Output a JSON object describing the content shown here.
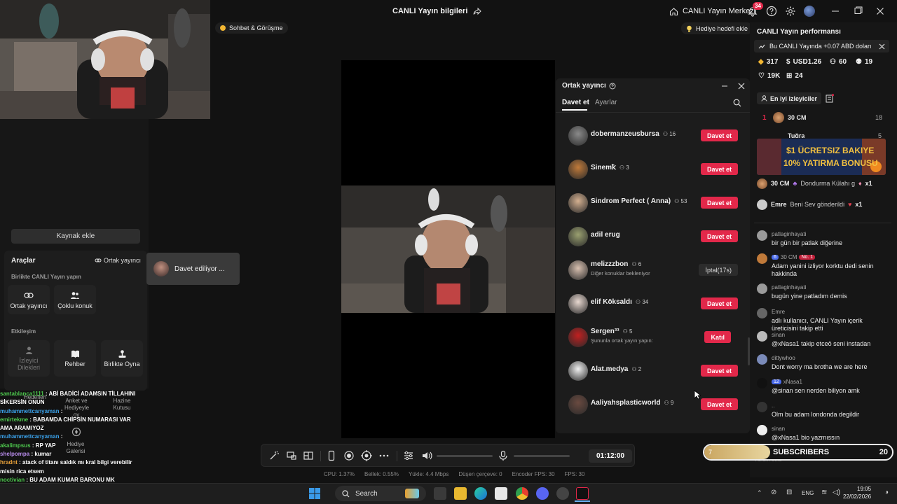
{
  "titlebar": {
    "title": "CANLI Yayın bilgileri",
    "live_center": "CANLI Yayın Merkezi",
    "notifications": "34"
  },
  "left": {
    "kaynak_ekle": "Kaynak ekle",
    "tools_title": "Araçlar",
    "ortak_link": "Ortak yayıncı",
    "section_together": "Birlikte CANLI Yayın yapın",
    "tile_ortak": "Ortak yayıncı",
    "tile_coklu": "Çoklu konuk",
    "section_interaction": "Etkileşim",
    "tile_izleyici": "İzleyici Dilekleri",
    "tile_rehber": "Rehber",
    "tile_birlikte_oyna": "Birlikte Oyna",
    "tile_anket": "Anket ve Hediyeyle oy",
    "tile_hazine": "Hazine Kutusu",
    "tile_hediye_galerisi": "Hediye Galerisi",
    "tile_hedefleri": "Hedefleri",
    "invite_toast": "Davet ediliyor ..."
  },
  "chat_overlay": [
    {
      "user": "santablanca1111",
      "text": ": ABİ BADİCİ ADAMSIN TİLLAHINI SİKERSİN ONUN",
      "color": "#4ec94e"
    },
    {
      "user": "muhammettcanyaman",
      "text": ":",
      "color": "#3aa0e8"
    },
    {
      "user": "emirtekme",
      "text": ": BABAMDA CHİPSİN NUMARASI VAR AMA ARAMIYOZ",
      "color": "#4ec94e"
    },
    {
      "user": "muhammettcanyaman",
      "text": ":",
      "color": "#3aa0e8"
    },
    {
      "user": "akalimpsus",
      "text": ": RP YAP",
      "color": "#4ec94e"
    },
    {
      "user": "shelpompa",
      "text": ": kumar",
      "color": "#b58ae8"
    },
    {
      "user": "hradnt",
      "text": ": atack of titanı saldık mı kral bilgi verebilir misin rica etsem",
      "color": "#e8a13a"
    },
    {
      "user": "noctivian",
      "text": ": BU ADAM KUMAR BARONU MK TEHLİKEDE DEĞİL TEHLİKENİN KENDİSİ MUSDAFA YÜZÜDÜK",
      "color": "#4ec94e"
    }
  ],
  "stage": {
    "sohbet": "Sohbet & Görüşme",
    "hediye_hedefi": "Hediye hedefi ekle"
  },
  "cohost": {
    "title": "Ortak yayıncı",
    "tab_invite": "Davet et",
    "tab_settings": "Ayarlar",
    "rows": [
      {
        "name": "dobermanzeusbursa",
        "count": "16",
        "button": "Davet et",
        "sub": ""
      },
      {
        "name": "Sinemꝁ",
        "count": "3",
        "button": "Davet et",
        "sub": ""
      },
      {
        "name": "Sindrom Perfect ( Anna)",
        "count": "53",
        "button": "Davet et",
        "sub": ""
      },
      {
        "name": "adil erug",
        "count": "",
        "button": "Davet et",
        "sub": ""
      },
      {
        "name": "melizzzbon",
        "count": "6",
        "button": "İptal(17s)",
        "sub": "Diğer konuklar bekleniyor"
      },
      {
        "name": "elif Köksaldı",
        "count": "34",
        "button": "Davet et",
        "sub": ""
      },
      {
        "name": "Sergen³³",
        "count": "5",
        "button": "Katıl",
        "sub": "Şununla ortak yayın yapın:"
      },
      {
        "name": "Alat.medya",
        "count": "2",
        "button": "Davet et",
        "sub": ""
      },
      {
        "name": "Aaliyahsplasticworld",
        "count": "9",
        "button": "Davet et",
        "sub": ""
      }
    ]
  },
  "toolbar": {
    "time": "01:12:00"
  },
  "stats": [
    "CPU: 1.37%",
    "Bellek: 0.55%",
    "Yükle: 4.4 Mbps",
    "Düşen çerçeve: 0",
    "Encoder FPS: 30",
    "FPS: 30"
  ],
  "right": {
    "title": "CANLI Yayın performansı",
    "earn": "Bu CANLI Yayında +0.07 ABD doları",
    "stat_diamonds": "317",
    "stat_usd": "USD1.26",
    "stat_viewers": "60",
    "stat_users": "19",
    "stat_likes": "19K",
    "stat_gifts": "24",
    "best_viewers": "En iyi izleyiciler",
    "top1_rank": "1",
    "top1_name": "30 CM",
    "top1_val": "18",
    "top2_name": "Tuğra",
    "top2_val": "5",
    "ad_line1": "$1 ÜCRETSIZ BAKIYE",
    "ad_line2": "10% YATIRMA BONUSU",
    "gift1_user": "30 CM",
    "gift1_text": "Dondurma Külahı g",
    "gift1_count": "x1",
    "gift2_user": "Emre",
    "gift2_text": "Beni Sev gönderildi",
    "gift2_count": "x1",
    "comment_placeholder": "Yorum ekle"
  },
  "chat": [
    {
      "user": "patlaginhayati",
      "text": "bir gün bir patlak diğerine"
    },
    {
      "user": "30 CM",
      "badge1": "6",
      "badge2": "No. 1",
      "text": "Adam yanini izliyor korktu dedi senin hakkinda"
    },
    {
      "user": "patlaginhayati",
      "text": "bugün yine patladım demis"
    },
    {
      "user": "Emre",
      "text": "adlı kullanıcı, CANLI Yayın içerik üreticisini takip etti"
    },
    {
      "user": "sinan",
      "text": "@xNasa1 takip etceö seni instadan"
    },
    {
      "user": "dittywhoo",
      "text": "Dont worry ma brotha we are here"
    },
    {
      "user": "xNasa1",
      "badge1": "12",
      "text": "@sinan sen nerden biliyon amk"
    },
    {
      "user": "..",
      "text": "Olm bu adam londonda degildir"
    },
    {
      "user": "sinan",
      "text": "@xNasa1 bio yazmıssın"
    }
  ],
  "subs": {
    "current": "7",
    "label": "SUBSCRIBERS",
    "goal": "20",
    "progress": 0.35
  },
  "taskbar": {
    "search": "Search",
    "lang": "ENG",
    "time": "19:05",
    "date": "22/02/2026"
  }
}
